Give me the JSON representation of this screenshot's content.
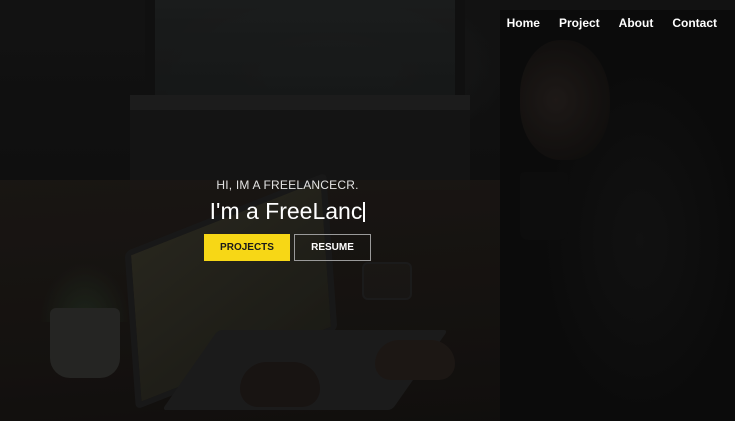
{
  "nav": {
    "items": [
      {
        "label": "Home"
      },
      {
        "label": "Project"
      },
      {
        "label": "About"
      },
      {
        "label": "Contact"
      }
    ]
  },
  "hero": {
    "intro": "HI, IM A FREELANCECR.",
    "headline": "I'm a FreeLanc",
    "buttons": {
      "primary_label": "PROJECTS",
      "secondary_label": "RESUME"
    }
  },
  "colors": {
    "accent": "#f7d716",
    "text": "#ffffff",
    "overlay": "#000000"
  }
}
